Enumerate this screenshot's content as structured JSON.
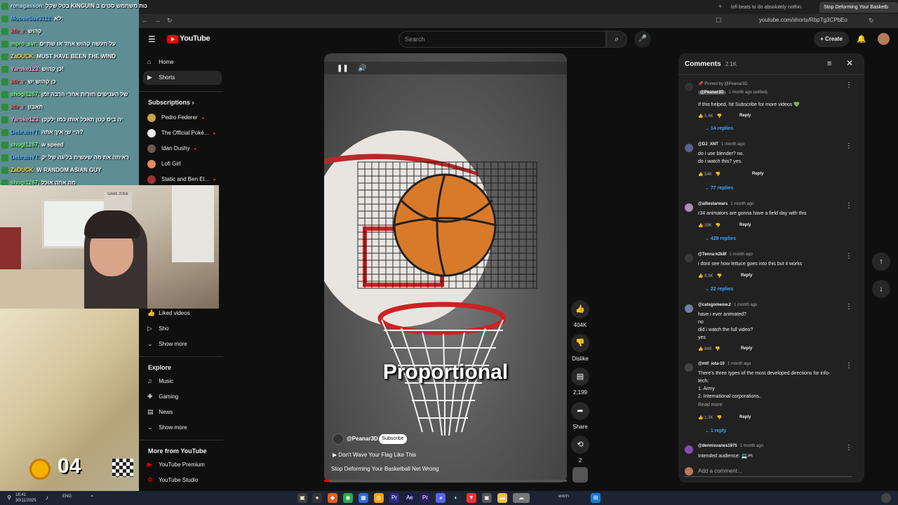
{
  "browser": {
    "tabs": [
      {
        "label": "lofi beats to do absolutely nothin"
      },
      {
        "label": "Stop Deforming Your Basketb"
      }
    ],
    "url": "youtube.com/shorts/RbpTg3CPbEo"
  },
  "youtube": {
    "logo": "YouTube",
    "search_placeholder": "Search",
    "create_label": "Create"
  },
  "sidebar": {
    "home": "Home",
    "shorts": "Shorts",
    "subscriptions_heading": "Subscriptions",
    "subscriptions": [
      {
        "name": "Pedro Federer",
        "color": "#caa24a"
      },
      {
        "name": "The Official Poké...",
        "color": "#e9e9e9"
      },
      {
        "name": "Idan Dushy",
        "color": "#6c5a4e"
      },
      {
        "name": "Lofi Girl",
        "color": "#e58b54"
      },
      {
        "name": "Static and Ben El...",
        "color": "#9d3333"
      }
    ],
    "liked_videos": "Liked videos",
    "sho": "Sho",
    "show_more_1": "Show more",
    "explore_heading": "Explore",
    "explore": [
      {
        "label": "Music"
      },
      {
        "label": "Gaming"
      },
      {
        "label": "News"
      }
    ],
    "show_more_2": "Show more",
    "more_heading": "More from YouTube",
    "more": [
      {
        "label": "YouTube Premium"
      },
      {
        "label": "YouTube Studio"
      }
    ]
  },
  "chat": [
    {
      "user": "ronagasson",
      "msg": "בטל שקל KINGUIN אתה יכול לקנות משתמש סטים ב",
      "color": "#bde5ff"
    },
    {
      "user": "MooseSue3112",
      "msg": "לא:",
      "color": "#4fb1ff"
    },
    {
      "user": "kfir_r",
      "msg": "קהוש",
      "color": "#ff5a5a"
    },
    {
      "user": "mpro_svr",
      "msg": "על תעשה קהוש אחד או שתיים",
      "color": "#7cff7c"
    },
    {
      "user": "ZaDUCK",
      "msg": "MUST HAVE BEEN THE WIND",
      "color": "#ffd54a"
    },
    {
      "user": "Yaroke123",
      "msg": "כן קהוש!",
      "color": "#ff9cd0"
    },
    {
      "user": "kfir_r",
      "msg": "כן קהוש יש",
      "color": "#ff5a5a"
    },
    {
      "user": "shogi1267",
      "msg": "של הענישים חזרות אחרי הרבה זמן",
      "color": "#7cff7c"
    },
    {
      "user": "kfir_r",
      "msg": "תאבון",
      "color": "#ff5a5a"
    },
    {
      "user": "Yaroke123",
      "msg": "יה ביס קטן תאכל אותו כמו ילקקן",
      "color": "#ff9cd0"
    },
    {
      "user": "DebrainYT",
      "msg": "היי שי איך אתה?",
      "color": "#4fb1ff"
    },
    {
      "user": "shogi1267",
      "msg": "w speed",
      "color": "#7cff7c"
    },
    {
      "user": "DebrainYT",
      "msg": "ראיתה את מה שעשית בליגה של יק",
      "color": "#4fb1ff"
    },
    {
      "user": "ZaDUCK",
      "msg": "W RANDOM ASIAN GUY",
      "color": "#ffd54a"
    },
    {
      "user": "shogi1267",
      "msg": "מה אתה אוכל",
      "color": "#7cff7c"
    }
  ],
  "game_overlay": {
    "counter": "04"
  },
  "webcam_sign": "GAME ZONE",
  "video": {
    "caption": "Proportional",
    "channel": "@Peanar3D",
    "subscribe": "Subscribe",
    "music": "Don't Wave Your Flag Like This",
    "title": "Stop Deforming Your Basketball Net Wrong",
    "progress": 0.02
  },
  "actions": {
    "likes": "404K",
    "dislike": "Dislike",
    "comments": "2,199",
    "share": "Share",
    "remix": "2"
  },
  "comments": {
    "title": "Comments",
    "count": "2.1K",
    "add_placeholder": "Add a comment...",
    "items": [
      {
        "pinned_by": "Pinned by @Peanar3D",
        "author": "@Peanar3D",
        "ago": "1 month ago (edited)",
        "lines": [
          "If this helped, hit Subscribe for more videos 💚"
        ],
        "likes": "5.4K",
        "replies": "14 replies",
        "color": "#333"
      },
      {
        "author": "@DJ_XNT",
        "ago": "1 month ago",
        "lines": [
          "do i use blender? no.",
          "do i watch this? yes."
        ],
        "likes": "54K",
        "replies": "77 replies",
        "color": "#5a5f8a"
      },
      {
        "author": "@alliestarwars",
        "ago": "1 month ago",
        "lines": [
          "r34 animators are gonna have a field day with this"
        ],
        "likes": "39K",
        "replies": "428 replies",
        "color": "#b58bb0"
      },
      {
        "author": "@Tenna-k2k8f",
        "ago": "1 month ago",
        "lines": [
          "i dont see how lettuce goes into this but it works"
        ],
        "likes": "8.9K",
        "replies": "22 replies",
        "color": "#3a3a3a"
      },
      {
        "author": "@catsgomeow.2",
        "ago": "1 month ago",
        "lines": [
          "have i ever animated?",
          "no",
          "did i watch the full video?",
          "yes"
        ],
        "likes": "849",
        "replies": "",
        "color": "#6f7fa0"
      },
      {
        "author": "@mtf_iota-10",
        "ago": "1 month ago",
        "lines": [
          "There's three types of the most developed directions for info-",
          "tech:",
          "1. Army",
          "2. International corporations.."
        ],
        "read_more": "Read more",
        "likes": "1.3K",
        "replies": "1 reply",
        "color": "#444"
      },
      {
        "author": "@dennisvanes1975",
        "ago": "1 month ago",
        "lines": [
          "Intended audience: 💻🎮"
        ],
        "likes": "",
        "replies": "",
        "color": "#8a4ab0"
      }
    ],
    "reply_label": "Reply"
  },
  "taskbar": {
    "time": "18:41",
    "date": "30/11/2025",
    "lang": "ENG",
    "search_label": "חיפוש"
  }
}
